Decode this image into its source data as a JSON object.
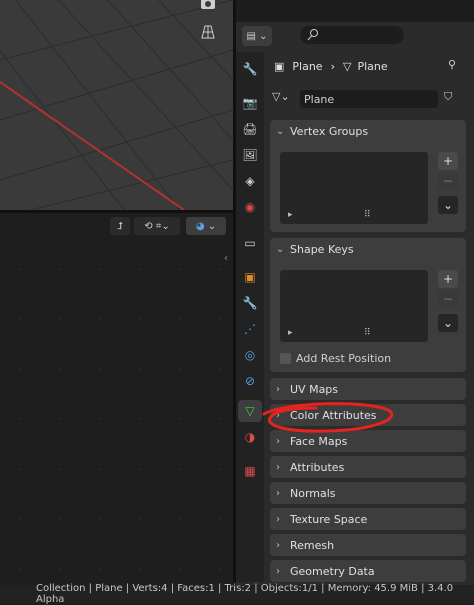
{
  "properties": {
    "breadcrumb_object": "Plane",
    "breadcrumb_mesh": "Plane",
    "mesh_name": "Plane"
  },
  "panels": {
    "vertex_groups": "Vertex Groups",
    "shape_keys": "Shape Keys",
    "add_rest_position": "Add Rest Position",
    "collapsed": [
      "UV Maps",
      "Color Attributes",
      "Face Maps",
      "Attributes",
      "Normals",
      "Texture Space",
      "Remesh",
      "Geometry Data"
    ]
  },
  "controls": {
    "plus": "+",
    "minus": "−",
    "chevron_down": "⌄",
    "arrow_right": "›",
    "pin": "📌"
  },
  "status": "Collection | Plane | Verts:4 | Faces:1 | Tris:2 | Objects:1/1 | Memory: 45.9 MiB | 3.4.0 Alpha",
  "colors": {
    "annotation": "#e4241f",
    "x_axis": "#c23a3a",
    "active_tab": "#4fa44a"
  },
  "icons": [
    "camera-icon",
    "grid-icon",
    "editor-type-icon",
    "search-icon",
    "tool-icon",
    "render-icon",
    "output-icon",
    "view-layer-icon",
    "scene-icon",
    "world-icon",
    "collection-icon",
    "object-icon",
    "modifier-icon",
    "particles-icon",
    "physics-icon",
    "constraints-icon",
    "data-icon",
    "material-icon",
    "texture-icon"
  ]
}
